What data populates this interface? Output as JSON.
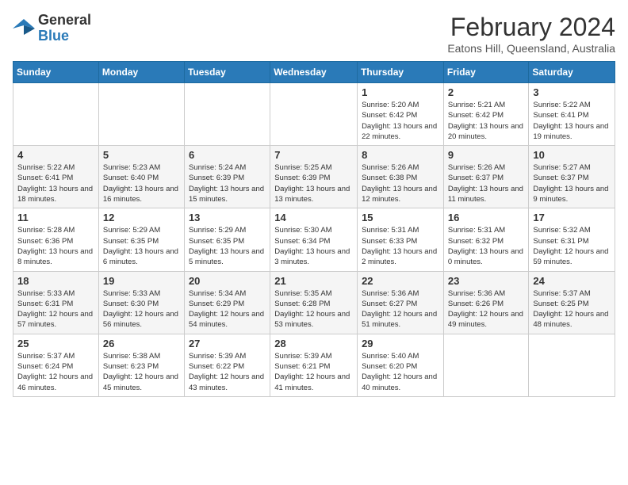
{
  "header": {
    "logo_general": "General",
    "logo_blue": "Blue",
    "month_title": "February 2024",
    "location": "Eatons Hill, Queensland, Australia"
  },
  "days_of_week": [
    "Sunday",
    "Monday",
    "Tuesday",
    "Wednesday",
    "Thursday",
    "Friday",
    "Saturday"
  ],
  "weeks": [
    [
      {
        "day": "",
        "info": ""
      },
      {
        "day": "",
        "info": ""
      },
      {
        "day": "",
        "info": ""
      },
      {
        "day": "",
        "info": ""
      },
      {
        "day": "1",
        "info": "Sunrise: 5:20 AM\nSunset: 6:42 PM\nDaylight: 13 hours and 22 minutes."
      },
      {
        "day": "2",
        "info": "Sunrise: 5:21 AM\nSunset: 6:42 PM\nDaylight: 13 hours and 20 minutes."
      },
      {
        "day": "3",
        "info": "Sunrise: 5:22 AM\nSunset: 6:41 PM\nDaylight: 13 hours and 19 minutes."
      }
    ],
    [
      {
        "day": "4",
        "info": "Sunrise: 5:22 AM\nSunset: 6:41 PM\nDaylight: 13 hours and 18 minutes."
      },
      {
        "day": "5",
        "info": "Sunrise: 5:23 AM\nSunset: 6:40 PM\nDaylight: 13 hours and 16 minutes."
      },
      {
        "day": "6",
        "info": "Sunrise: 5:24 AM\nSunset: 6:39 PM\nDaylight: 13 hours and 15 minutes."
      },
      {
        "day": "7",
        "info": "Sunrise: 5:25 AM\nSunset: 6:39 PM\nDaylight: 13 hours and 13 minutes."
      },
      {
        "day": "8",
        "info": "Sunrise: 5:26 AM\nSunset: 6:38 PM\nDaylight: 13 hours and 12 minutes."
      },
      {
        "day": "9",
        "info": "Sunrise: 5:26 AM\nSunset: 6:37 PM\nDaylight: 13 hours and 11 minutes."
      },
      {
        "day": "10",
        "info": "Sunrise: 5:27 AM\nSunset: 6:37 PM\nDaylight: 13 hours and 9 minutes."
      }
    ],
    [
      {
        "day": "11",
        "info": "Sunrise: 5:28 AM\nSunset: 6:36 PM\nDaylight: 13 hours and 8 minutes."
      },
      {
        "day": "12",
        "info": "Sunrise: 5:29 AM\nSunset: 6:35 PM\nDaylight: 13 hours and 6 minutes."
      },
      {
        "day": "13",
        "info": "Sunrise: 5:29 AM\nSunset: 6:35 PM\nDaylight: 13 hours and 5 minutes."
      },
      {
        "day": "14",
        "info": "Sunrise: 5:30 AM\nSunset: 6:34 PM\nDaylight: 13 hours and 3 minutes."
      },
      {
        "day": "15",
        "info": "Sunrise: 5:31 AM\nSunset: 6:33 PM\nDaylight: 13 hours and 2 minutes."
      },
      {
        "day": "16",
        "info": "Sunrise: 5:31 AM\nSunset: 6:32 PM\nDaylight: 13 hours and 0 minutes."
      },
      {
        "day": "17",
        "info": "Sunrise: 5:32 AM\nSunset: 6:31 PM\nDaylight: 12 hours and 59 minutes."
      }
    ],
    [
      {
        "day": "18",
        "info": "Sunrise: 5:33 AM\nSunset: 6:31 PM\nDaylight: 12 hours and 57 minutes."
      },
      {
        "day": "19",
        "info": "Sunrise: 5:33 AM\nSunset: 6:30 PM\nDaylight: 12 hours and 56 minutes."
      },
      {
        "day": "20",
        "info": "Sunrise: 5:34 AM\nSunset: 6:29 PM\nDaylight: 12 hours and 54 minutes."
      },
      {
        "day": "21",
        "info": "Sunrise: 5:35 AM\nSunset: 6:28 PM\nDaylight: 12 hours and 53 minutes."
      },
      {
        "day": "22",
        "info": "Sunrise: 5:36 AM\nSunset: 6:27 PM\nDaylight: 12 hours and 51 minutes."
      },
      {
        "day": "23",
        "info": "Sunrise: 5:36 AM\nSunset: 6:26 PM\nDaylight: 12 hours and 49 minutes."
      },
      {
        "day": "24",
        "info": "Sunrise: 5:37 AM\nSunset: 6:25 PM\nDaylight: 12 hours and 48 minutes."
      }
    ],
    [
      {
        "day": "25",
        "info": "Sunrise: 5:37 AM\nSunset: 6:24 PM\nDaylight: 12 hours and 46 minutes."
      },
      {
        "day": "26",
        "info": "Sunrise: 5:38 AM\nSunset: 6:23 PM\nDaylight: 12 hours and 45 minutes."
      },
      {
        "day": "27",
        "info": "Sunrise: 5:39 AM\nSunset: 6:22 PM\nDaylight: 12 hours and 43 minutes."
      },
      {
        "day": "28",
        "info": "Sunrise: 5:39 AM\nSunset: 6:21 PM\nDaylight: 12 hours and 41 minutes."
      },
      {
        "day": "29",
        "info": "Sunrise: 5:40 AM\nSunset: 6:20 PM\nDaylight: 12 hours and 40 minutes."
      },
      {
        "day": "",
        "info": ""
      },
      {
        "day": "",
        "info": ""
      }
    ]
  ]
}
